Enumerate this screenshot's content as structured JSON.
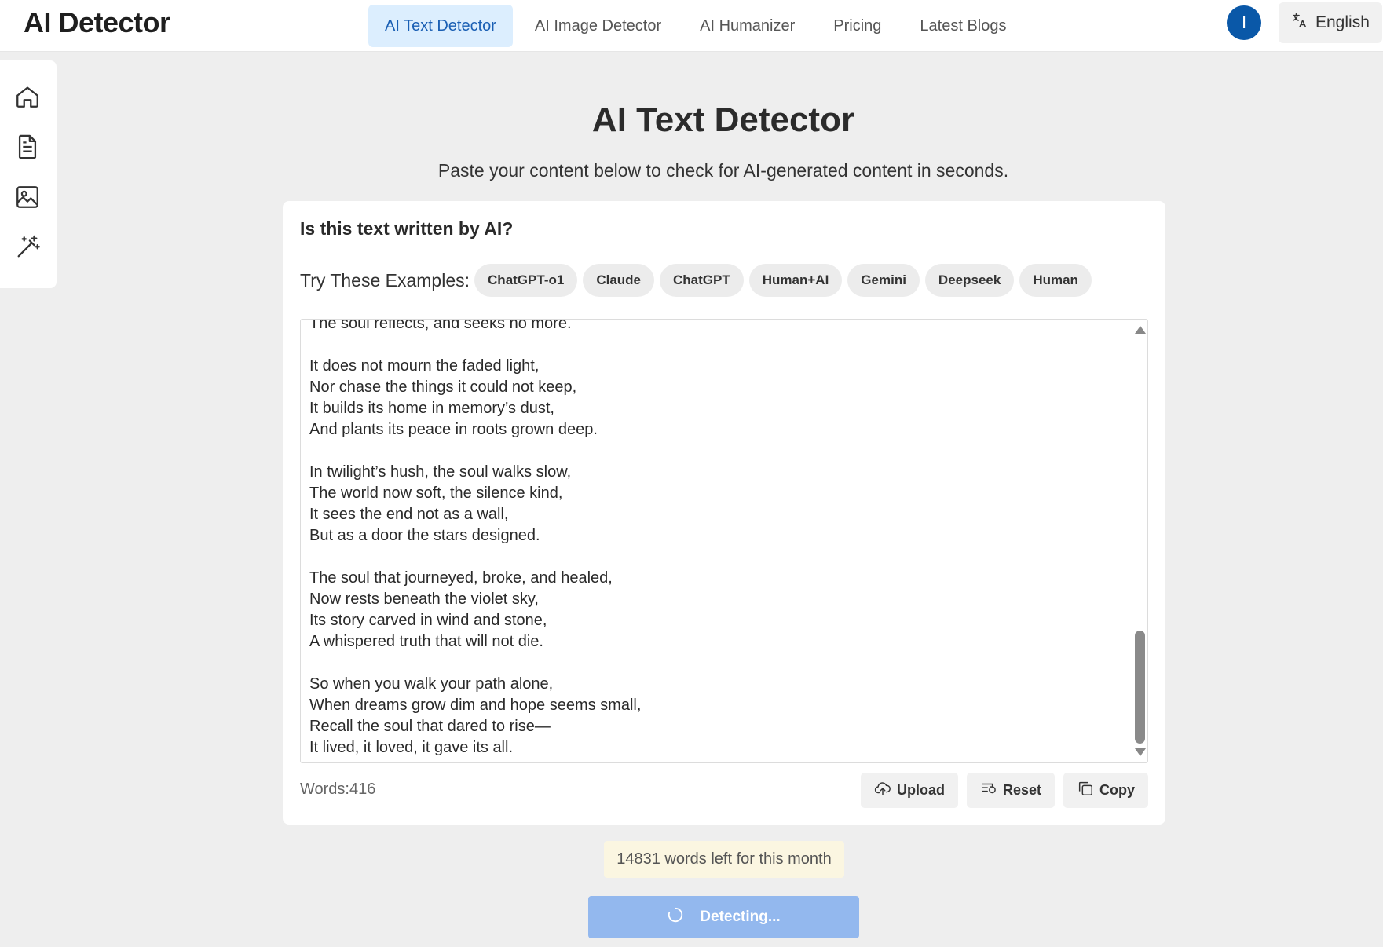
{
  "header": {
    "logo": "AI Detector",
    "nav": [
      {
        "label": "AI Text Detector",
        "active": true
      },
      {
        "label": "AI Image Detector",
        "active": false
      },
      {
        "label": "AI Humanizer",
        "active": false
      },
      {
        "label": "Pricing",
        "active": false
      },
      {
        "label": "Latest Blogs",
        "active": false
      }
    ],
    "avatar_initial": "I",
    "language": "English"
  },
  "sidebar": {
    "items": [
      "home-icon",
      "document-icon",
      "image-icon",
      "magic-wand-icon"
    ]
  },
  "main": {
    "title": "AI Text Detector",
    "subtitle": "Paste your content below to check for AI-generated content in seconds."
  },
  "card": {
    "question": "Is this text written by AI?",
    "examples_label": "Try These Examples:",
    "examples": [
      "ChatGPT-o1",
      "Claude",
      "ChatGPT",
      "Human+AI",
      "Gemini",
      "Deepseek",
      "Human"
    ],
    "editor_text": "The soul reflects, and seeks no more.\n\nIt does not mourn the faded light,\nNor chase the things it could not keep,\nIt builds its home in memory’s dust,\nAnd plants its peace in roots grown deep.\n\nIn twilight’s hush, the soul walks slow,\nThe world now soft, the silence kind,\nIt sees the end not as a wall,\nBut as a door the stars designed.\n\nThe soul that journeyed, broke, and healed,\nNow rests beneath the violet sky,\nIts story carved in wind and stone,\nA whispered truth that will not die.\n\nSo when you walk your path alone,\nWhen dreams grow dim and hope seems small,\nRecall the soul that dared to rise—\nIt lived, it loved, it gave its all.",
    "word_count": "Words:416",
    "actions": {
      "upload": "Upload",
      "reset": "Reset",
      "copy": "Copy"
    }
  },
  "quota_text": "14831 words left for this month",
  "detect_button": "Detecting...",
  "colors": {
    "accent": "#1a5fb4",
    "nav_active_bg": "#dceefe",
    "avatar": "#0a58a8",
    "detect_button": "#93b8ee",
    "quota_bg": "#fbf6e1",
    "page_bg": "#eeeeee"
  }
}
